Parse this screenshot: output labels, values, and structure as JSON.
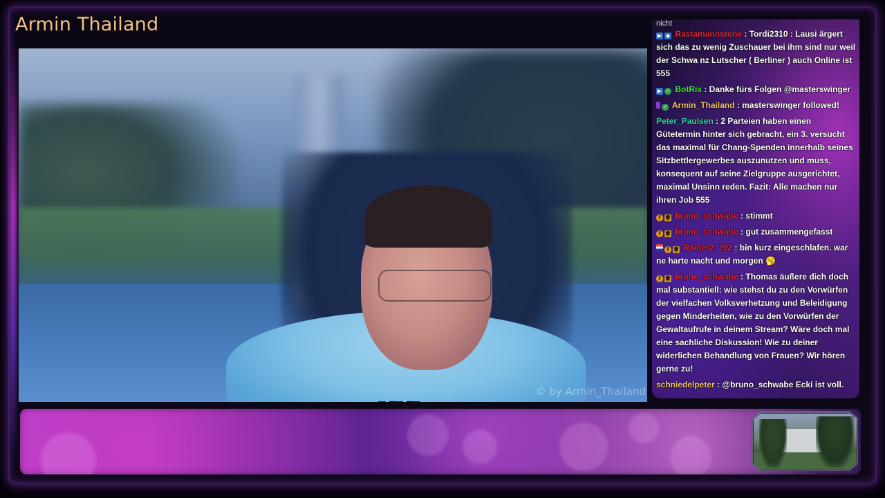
{
  "stream": {
    "title": "Armin Thailand",
    "watermark": "© by Armin_Thailand"
  },
  "chat": {
    "cut_top_text": "nicht",
    "messages": [
      {
        "badges": [
          "prime-icon",
          "bits-icon"
        ],
        "user": "Rastamannstone",
        "user_color": "#e0283c",
        "text": "Tordi2310 : Lausi ärgert sich das zu wenig Zuschauer bei ihm sind nur weil der Schwa nz Lutscher ( Berliner ) auch Online ist 555"
      },
      {
        "badges": [
          "prime-icon",
          "verified-icon"
        ],
        "user": "BotRix",
        "user_color": "#46e04a",
        "text": "Danke fürs Folgen @masterswinger"
      },
      {
        "badges": [
          "broadcaster-icon",
          "verified-icon"
        ],
        "user": "Armin_Thailand",
        "user_color": "#f2c36b",
        "text": "masterswinger followed!"
      },
      {
        "badges": [],
        "user": "Peter_Paulsen",
        "user_color": "#2fd6a6",
        "text": "2 Parteien haben einen Gütetermin hinter sich gebracht, ein 3. versucht das maximal für Chang-Spenden innerhalb seines Sitzbettlergewerbes auszunutzen und muss, konsequent auf seine Zielgruppe ausgerichtet, maximal Unsinn reden. Fazit: Alle machen nur ihren Job 555"
      },
      {
        "badges": [
          "gold-badge-icon",
          "crown-icon"
        ],
        "user": "bruno_schwabe",
        "user_color": "#e0283c",
        "text": "stimmt"
      },
      {
        "badges": [
          "gold-badge-icon",
          "crown-icon"
        ],
        "user": "bruno_schwabe",
        "user_color": "#e0283c",
        "text": "gut zusammengefasst"
      },
      {
        "badges": [
          "flag-icon",
          "gold-badge-icon",
          "crown-icon"
        ],
        "user": "Rainer2_292",
        "user_color": "#e0283c",
        "text": "bin kurz eingeschlafen. war ne harte nacht und morgen 🥱"
      },
      {
        "badges": [
          "gold-badge-icon",
          "crown-icon"
        ],
        "user": "bruno_schwabe",
        "user_color": "#e0283c",
        "text": "Thomas äußere dich doch mal substantiell: wie stehst du zu den Vorwürfen der vielfachen Volksverhetzung und Beleidigung gegen Minderheiten, wie zu den Vorwürfen der Gewaltaufrufe in deinem Stream? Wäre doch mal eine sachliche Diskussion! Wie zu deiner widerlichen Behandlung von Frauen? Wir hören gerne zu!"
      },
      {
        "badges": [],
        "user": "schniedelpeter",
        "user_color": "#f2c36b",
        "text": "@bruno_schwabe Ecki ist voll."
      }
    ]
  }
}
